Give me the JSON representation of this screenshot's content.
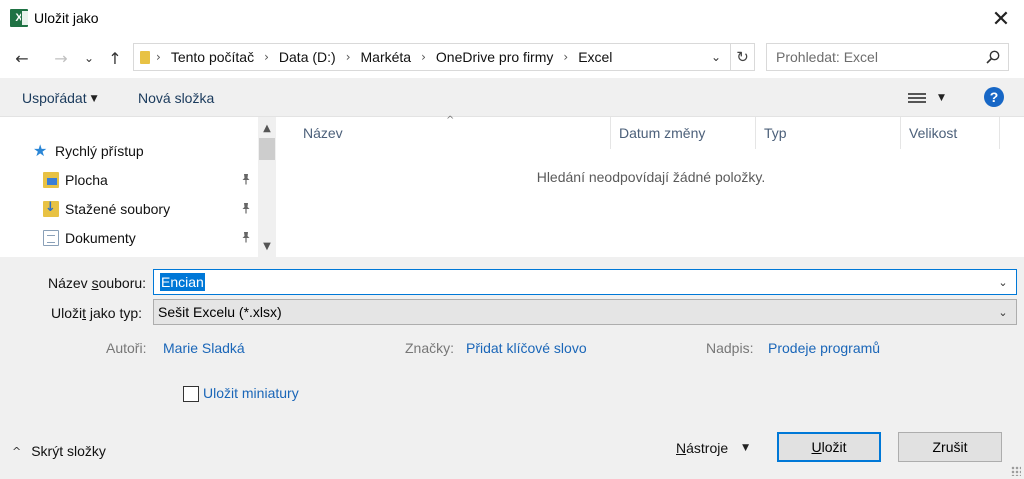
{
  "window": {
    "title": "Uložit jako",
    "app_icon": "excel-icon",
    "close_glyph": "✕"
  },
  "nav": {
    "back_glyph": "←",
    "forward_glyph": "→",
    "recent_glyph": "⌄",
    "up_glyph": "↑",
    "breadcrumbs": [
      "Tento počítač",
      "Data (D:)",
      "Markéta",
      "OneDrive pro firmy",
      "Excel"
    ],
    "sep_glyph": "›",
    "dropdown_glyph": "⌄",
    "refresh_glyph": "↻",
    "search_placeholder": "Prohledat: Excel",
    "search_glyph": "⚲"
  },
  "toolbar": {
    "organize_label": "Uspořádat",
    "caret_glyph": "▼",
    "new_folder_label": "Nová složka",
    "help_label": "?"
  },
  "navpane": {
    "quick_access_label": "Rychlý přístup",
    "star_glyph": "★",
    "pin_glyph": "⚲",
    "items": [
      {
        "label": "Plocha",
        "icon": "desktop-folder-icon"
      },
      {
        "label": "Stažené soubory",
        "icon": "downloads-folder-icon"
      },
      {
        "label": "Dokumenty",
        "icon": "documents-icon"
      }
    ],
    "scroll_up_glyph": "▲",
    "scroll_down_glyph": "▼"
  },
  "filepane": {
    "columns": [
      "Název",
      "Datum změny",
      "Typ",
      "Velikost"
    ],
    "sort_glyph": "^",
    "empty_message": "Hledání neodpovídají žádné položky."
  },
  "form": {
    "filename_label_pre": "Název ",
    "filename_label_ul": "s",
    "filename_label_post": "ouboru:",
    "filename_value": "Encian",
    "type_label_pre": "Uloži",
    "type_label_ul": "t",
    "type_label_post": " jako typ:",
    "type_value": "Sešit Excelu (*.xlsx)",
    "dd_glyph": "⌄",
    "authors_label": "Autoři:",
    "authors_value": "Marie Sladká",
    "tags_label": "Značky:",
    "tags_value": "Přidat klíčové slovo",
    "title_label": "Nadpis:",
    "title_value": "Prodeje programů",
    "thumbnail_label": "Uložit miniatury"
  },
  "footer": {
    "hide_folders_glyph": "^",
    "hide_folders_label": "Skrýt složky",
    "tools_label_ul": "N",
    "tools_label_rest": "ástroje",
    "tools_caret": "▼",
    "save_label_ul": "U",
    "save_label_rest": "ložit",
    "cancel_label": "Zrušit"
  }
}
